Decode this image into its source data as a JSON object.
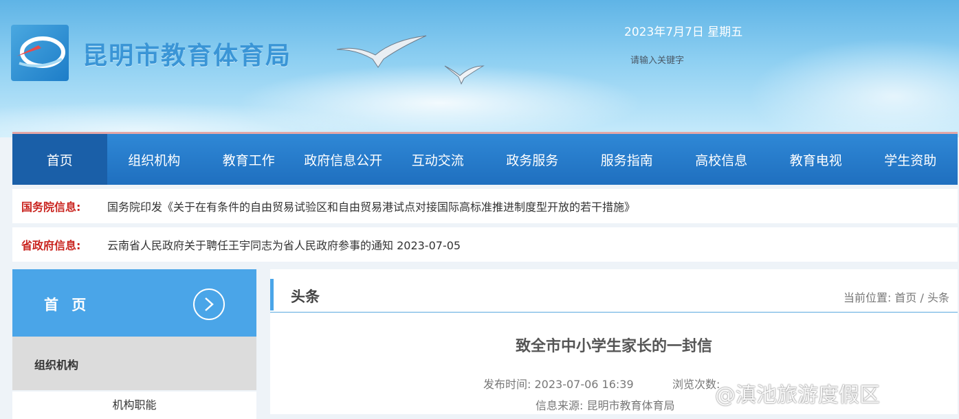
{
  "header": {
    "site_name": "昆明市教育体育局",
    "date": "2023年7月7日 星期五",
    "search_placeholder": "请输入关键字"
  },
  "nav": {
    "items": [
      {
        "label": "首页"
      },
      {
        "label": "组织机构"
      },
      {
        "label": "教育工作"
      },
      {
        "label": "政府信息公开"
      },
      {
        "label": "互动交流"
      },
      {
        "label": "政务服务"
      },
      {
        "label": "服务指南"
      },
      {
        "label": "高校信息"
      },
      {
        "label": "教育电视"
      },
      {
        "label": "学生资助"
      }
    ]
  },
  "info": {
    "state_council_label": "国务院信息:",
    "state_council_text": "国务院印发《关于在有条件的自由贸易试验区和自由贸易港试点对接国际高标准推进制度型开放的若干措施》",
    "province_label": "省政府信息:",
    "province_text": "云南省人民政府关于聘任王宇同志为省人民政府参事的通知 2023-07-05"
  },
  "sidebar": {
    "home_label": "首 页",
    "section_label": "组织机构",
    "sub_label": "机构职能"
  },
  "content": {
    "heading": "头条",
    "breadcrumb": "当前位置:  首页 / 头条",
    "article_title": "致全市中小学生家长的一封信",
    "publish_time": "发布时间:  2023-07-06 16:39",
    "views": "浏览次数:",
    "source": "信息来源:  昆明市教育体育局"
  },
  "watermark": "@滇池旅游度假区",
  "colors": {
    "nav_bg": "#1f6fbf",
    "nav_active": "#1a5fa8",
    "info_label": "#c9241f",
    "sidebar_home": "#4aa5e8"
  }
}
